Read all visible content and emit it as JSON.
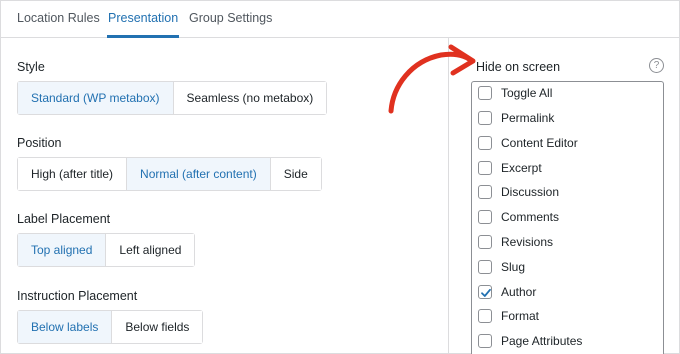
{
  "tabs": [
    {
      "label": "Location Rules",
      "active": false
    },
    {
      "label": "Presentation",
      "active": true
    },
    {
      "label": "Group Settings",
      "active": false
    }
  ],
  "style": {
    "label": "Style",
    "options": [
      "Standard (WP metabox)",
      "Seamless (no metabox)"
    ],
    "selected": "Standard (WP metabox)"
  },
  "position": {
    "label": "Position",
    "options": [
      "High (after title)",
      "Normal (after content)",
      "Side"
    ],
    "selected": "Normal (after content)"
  },
  "label_placement": {
    "label": "Label Placement",
    "options": [
      "Top aligned",
      "Left aligned"
    ],
    "selected": "Top aligned"
  },
  "instruction_placement": {
    "label": "Instruction Placement",
    "options": [
      "Below labels",
      "Below fields"
    ],
    "selected": "Below labels"
  },
  "hide_on_screen": {
    "title": "Hide on screen",
    "help_icon": "question-mark-circle-icon",
    "items": [
      {
        "label": "Toggle All",
        "checked": false
      },
      {
        "label": "Permalink",
        "checked": false
      },
      {
        "label": "Content Editor",
        "checked": false
      },
      {
        "label": "Excerpt",
        "checked": false
      },
      {
        "label": "Discussion",
        "checked": false
      },
      {
        "label": "Comments",
        "checked": false
      },
      {
        "label": "Revisions",
        "checked": false
      },
      {
        "label": "Slug",
        "checked": false
      },
      {
        "label": "Author",
        "checked": true
      },
      {
        "label": "Format",
        "checked": false
      },
      {
        "label": "Page Attributes",
        "checked": false
      }
    ]
  },
  "colors": {
    "accent": "#2271b1",
    "active_bg": "#f0f6fc",
    "border": "#dcdcde",
    "annotation": "#e0311f"
  }
}
